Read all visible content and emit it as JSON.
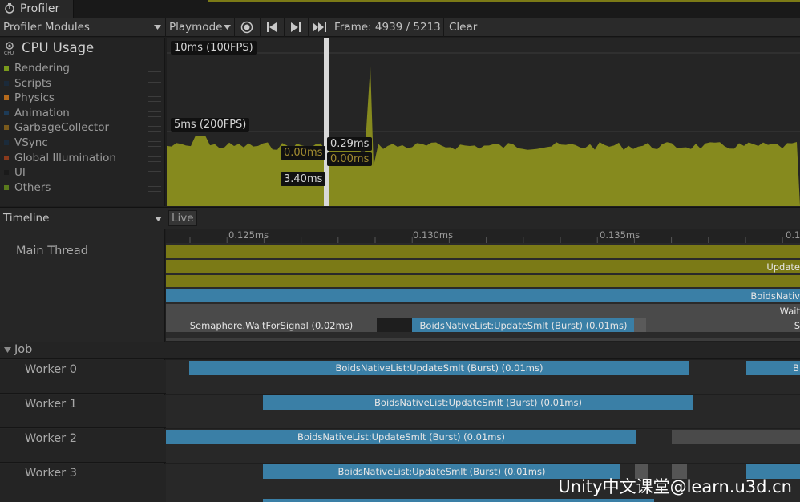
{
  "window": {
    "tab_label": "Profiler"
  },
  "toolbar": {
    "modules_label": "Profiler Modules",
    "mode_label": "Playmode",
    "frame_label": "Frame: 4939 / 5213",
    "clear_label": "Clear"
  },
  "cpu_module": {
    "title": "CPU Usage",
    "legend": [
      {
        "name": "Rendering",
        "color": "#7a9a1c"
      },
      {
        "name": "Scripts",
        "color": "#1b2a3a"
      },
      {
        "name": "Physics",
        "color": "#b56a1c"
      },
      {
        "name": "Animation",
        "color": "#1d3b57"
      },
      {
        "name": "GarbageCollector",
        "color": "#7a5a1c"
      },
      {
        "name": "VSync",
        "color": "#1b2b3b"
      },
      {
        "name": "Global Illumination",
        "color": "#8a3a1c"
      },
      {
        "name": "UI",
        "color": "#1a1a1a"
      },
      {
        "name": "Others",
        "color": "#5a7a1c"
      }
    ]
  },
  "graph": {
    "label_10ms": "10ms (100FPS)",
    "label_5ms": "5ms (200FPS)",
    "tooltip_left_top": "0.00ms",
    "tooltip_left_bottom": "3.40ms",
    "tooltip_right_top": "0.29ms",
    "tooltip_right_bottom": "0.00ms",
    "fill_color": "#868a1e"
  },
  "timeline": {
    "view_label": "Timeline",
    "live_label": "Live",
    "ticks": [
      "0.125ms",
      "0.130ms",
      "0.135ms",
      "0.1"
    ],
    "main_thread_label": "Main Thread",
    "main_bars": {
      "update_label": "Update",
      "boids_label": "BoidsNativ",
      "wait_label": "Wait",
      "semaphore_label": "Semaphore.WaitForSignal (0.02ms)",
      "main_boids_label": "BoidsNativeList:UpdateSmlt (Burst) (0.01ms)",
      "s_label": "S"
    },
    "job_group_label": "Job",
    "workers": [
      {
        "label": "Worker 0",
        "bar_label": "BoidsNativeList:UpdateSmlt (Burst) (0.01ms)",
        "extra_label": "B"
      },
      {
        "label": "Worker 1",
        "bar_label": "BoidsNativeList:UpdateSmlt (Burst) (0.01ms)"
      },
      {
        "label": "Worker 2",
        "bar_label": "BoidsNativeList:UpdateSmlt (Burst) (0.01ms)"
      },
      {
        "label": "Worker 3",
        "bar_label": "BoidsNativeList:UpdateSmlt (Burst) (0.01ms)"
      }
    ]
  },
  "watermark": "Unity中文课堂@learn.u3d.cn"
}
